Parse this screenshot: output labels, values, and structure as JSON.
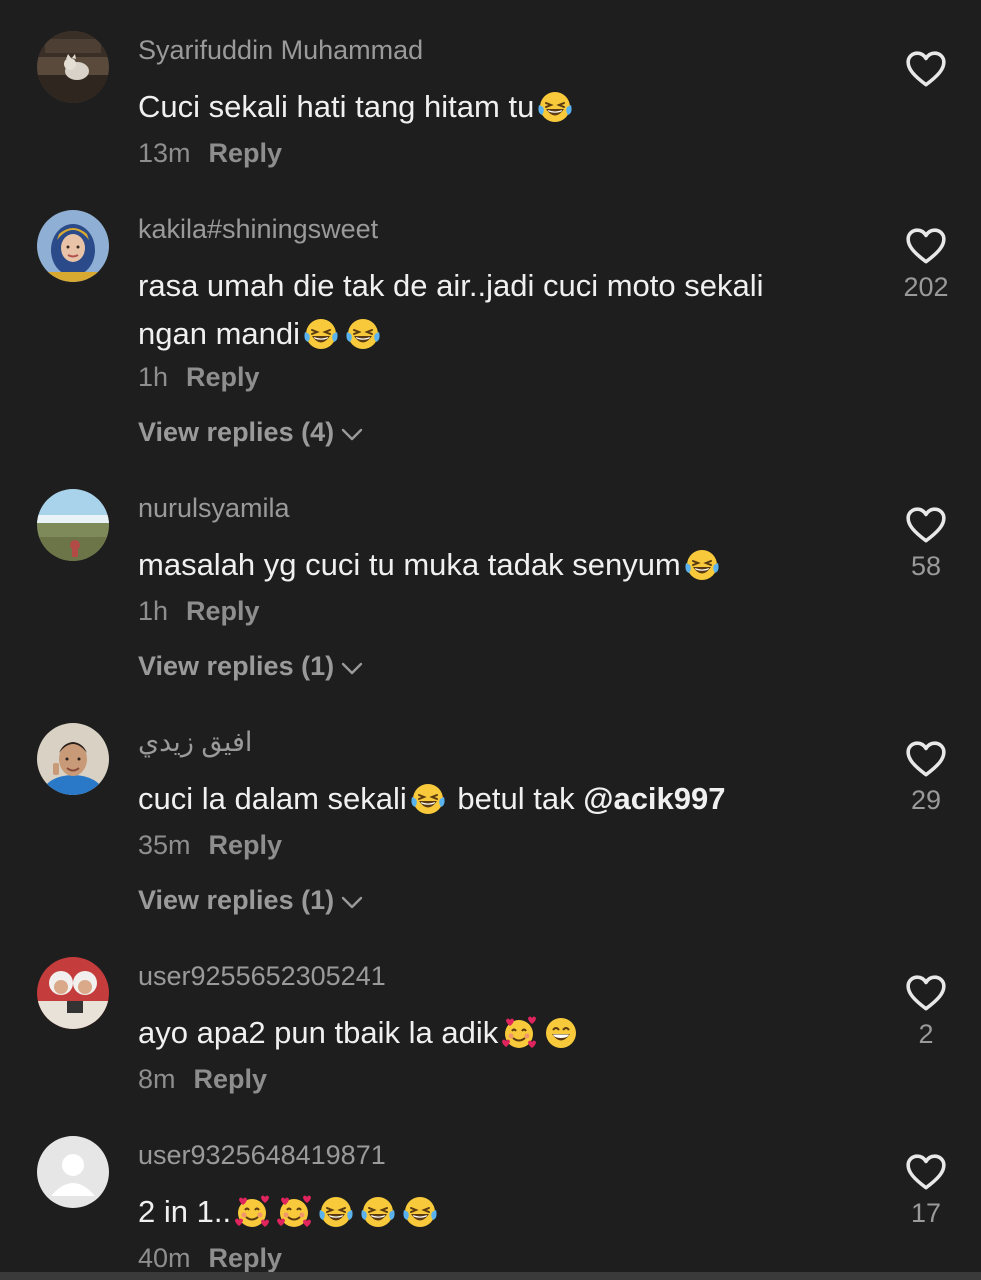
{
  "icons": {
    "like": "heart-outline-icon",
    "chevron": "chevron-down-icon",
    "laugh": "tears-of-joy-emoji",
    "hearts": "smiling-face-with-hearts-emoji",
    "grin": "beaming-face-emoji"
  },
  "colors": {
    "background": "#1e1e1e",
    "text": "#f0f0f0",
    "muted": "#8e8e8e"
  },
  "comments": [
    {
      "username": "Syarifuddin Muhammad",
      "text_parts": [
        "Cuci sekali hati tang hitam tu"
      ],
      "time": "13m",
      "reply": "Reply",
      "likes": "",
      "view_replies": ""
    },
    {
      "username": "kakila#shiningsweet",
      "text_parts": [
        "rasa umah die tak de air..jadi cuci moto sekali ngan mandi"
      ],
      "time": "1h",
      "reply": "Reply",
      "likes": "202",
      "view_replies": "View replies (4)"
    },
    {
      "username": "nurulsyamila",
      "text_parts": [
        "masalah yg cuci tu muka tadak senyum"
      ],
      "time": "1h",
      "reply": "Reply",
      "likes": "58",
      "view_replies": "View replies (1)"
    },
    {
      "username": "افيق زيدي",
      "text_parts": [
        "cuci la dalam sekali",
        " betul tak ",
        "@acik997"
      ],
      "time": "35m",
      "reply": "Reply",
      "likes": "29",
      "view_replies": "View replies (1)"
    },
    {
      "username": "user9255652305241",
      "text_parts": [
        "ayo apa2 pun tbaik la adik"
      ],
      "time": "8m",
      "reply": "Reply",
      "likes": "2",
      "view_replies": ""
    },
    {
      "username": "user9325648419871",
      "text_parts": [
        "2 in 1.."
      ],
      "time": "40m",
      "reply": "Reply",
      "likes": "17",
      "view_replies": ""
    }
  ]
}
